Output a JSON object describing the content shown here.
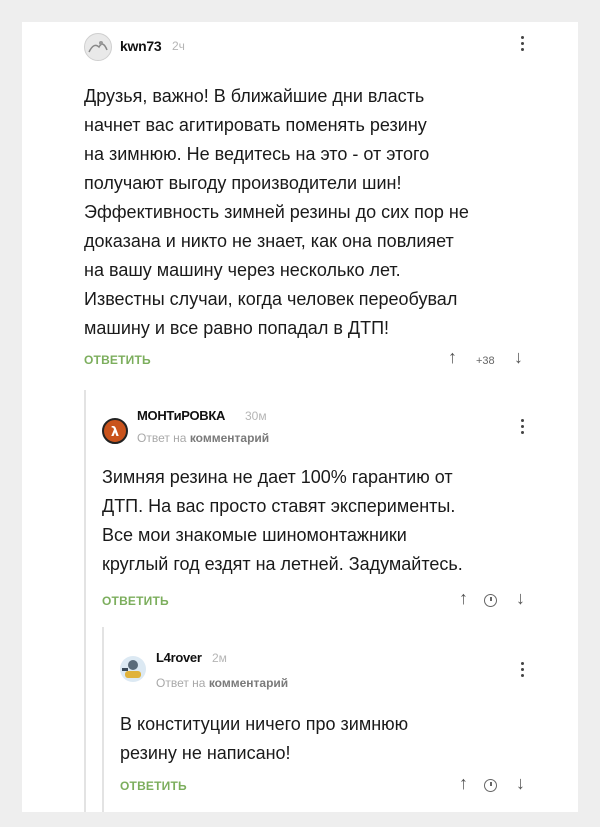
{
  "comments": [
    {
      "username": "kwn73",
      "time": "2ч",
      "text_lines": [
        "Друзья, важно! В ближайшие дни власть",
        "начнет вас агитировать поменять резину",
        "на зимнюю. Не ведитесь на это - от этого",
        "получают выгоду производители шин!",
        "Эффективность зимней резины до сих пор не",
        "доказана и никто не знает, как она повлияет",
        "на вашу машину через несколько лет.",
        "Известны случаи, когда человек переобувал",
        "машину и все равно попадал в ДТП!"
      ],
      "reply_label": "ОТВЕТИТЬ",
      "score": "+38",
      "up_icon": "arrow-up-icon",
      "down_icon": "arrow-down-icon"
    },
    {
      "username": "МОНТиРОВКА",
      "time": "30м",
      "reply_prefix": "Ответ на",
      "reply_target": "комментарий",
      "text_lines": [
        "Зимняя резина не дает 100% гарантию от",
        "ДТП. На вас просто ставят эксперименты.",
        "Все мои знакомые шиномонтажники",
        "круглый год ездят на летней. Задумайтесь."
      ],
      "reply_label": "ОТВЕТИТЬ",
      "score_icon": "clock-icon"
    },
    {
      "username": "L4rover",
      "time": "2м",
      "reply_prefix": "Ответ на",
      "reply_target": "комментарий",
      "text_lines": [
        "В конституции ничего про зимнюю",
        "резину не написано!"
      ],
      "reply_label": "ОТВЕТИТЬ",
      "score_icon": "clock-icon"
    }
  ],
  "colors": {
    "reply_green": "#7cae5d",
    "avatar2_orange": "#c9531c"
  }
}
